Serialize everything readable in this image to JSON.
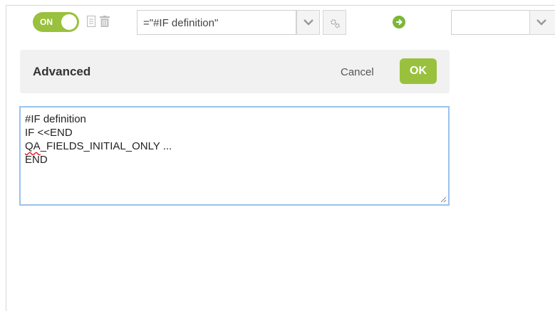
{
  "toolbar": {
    "toggle_label": "ON",
    "formula_value": "=\"#IF definition\""
  },
  "advanced": {
    "title": "Advanced",
    "cancel_label": "Cancel",
    "ok_label": "OK"
  },
  "editor": {
    "lines": [
      "#IF definition",
      "IF <<END",
      "QA",
      "_FIELDS_INITIAL_ONLY ...",
      "END"
    ]
  },
  "colors": {
    "accent_green": "#99c13d",
    "focus_blue": "#9bc2ea"
  },
  "icons": [
    "copy-icon",
    "trash-icon",
    "chevron-down-icon",
    "gears-icon",
    "arrow-right-circle-icon",
    "resize-grip-icon"
  ]
}
